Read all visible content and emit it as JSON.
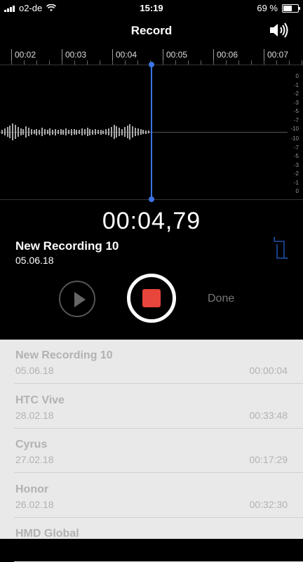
{
  "status": {
    "carrier": "o2-de",
    "time": "15:19",
    "battery": "69 %",
    "battery_level": 0.69
  },
  "nav": {
    "title": "Record"
  },
  "timeline": {
    "ticks": [
      "00:02",
      "00:03",
      "00:04",
      "00:05",
      "00:06",
      "00:07"
    ]
  },
  "db_scale": {
    "upper": [
      "0",
      "-1",
      "-2",
      "-3",
      "-5",
      "-7",
      "-10"
    ],
    "lower": [
      "-10",
      "-7",
      "-5",
      "-3",
      "-2",
      "-1",
      "0"
    ]
  },
  "current": {
    "timer": "00:04,79",
    "name": "New Recording 10",
    "date": "05.06.18"
  },
  "controls": {
    "done_label": "Done"
  },
  "recordings": [
    {
      "title": "New Recording 10",
      "date": "05.06.18",
      "duration": "00:00:04"
    },
    {
      "title": "HTC Vive",
      "date": "28.02.18",
      "duration": "00:33:48"
    },
    {
      "title": "Cyrus",
      "date": "27.02.18",
      "duration": "00:17:29"
    },
    {
      "title": "Honor",
      "date": "26.02.18",
      "duration": "00:32:30"
    },
    {
      "title": "HMD Global",
      "date": "",
      "duration": ""
    }
  ],
  "colors": {
    "accent": "#3b74e6",
    "record": "#e8453c"
  }
}
